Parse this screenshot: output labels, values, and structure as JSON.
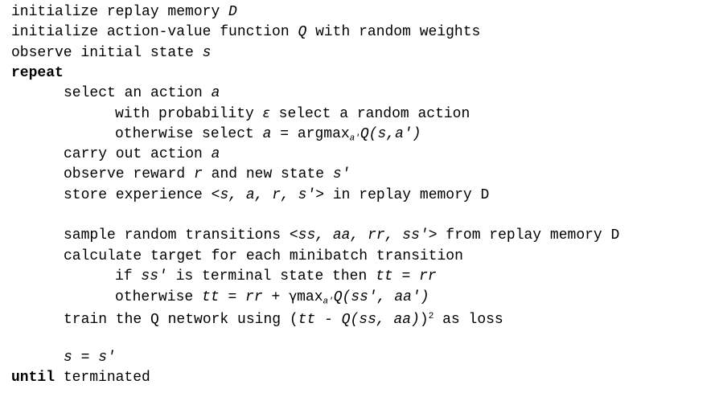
{
  "document": {
    "type": "algorithm-pseudocode",
    "title": "Deep Q-Learning with Experience Replay",
    "background_color": "#ffffff",
    "text_color": "#000000",
    "font_style": "monospace",
    "indent_char_width": 8
  },
  "lines": [
    {
      "id": "line-1",
      "indent": 0,
      "text": "initialize replay memory D",
      "segments": [
        {
          "t": "initialize replay memory ",
          "style": "plain"
        },
        {
          "t": "D",
          "style": "italic"
        }
      ]
    },
    {
      "id": "line-2",
      "indent": 0,
      "text": "initialize action-value function Q with random weights",
      "segments": [
        {
          "t": "initialize action-value function ",
          "style": "plain"
        },
        {
          "t": "Q",
          "style": "italic"
        },
        {
          "t": " with random weights",
          "style": "plain"
        }
      ]
    },
    {
      "id": "line-3",
      "indent": 0,
      "text": "observe initial state s",
      "segments": [
        {
          "t": "observe initial state ",
          "style": "plain"
        },
        {
          "t": "s",
          "style": "italic"
        }
      ]
    },
    {
      "id": "line-4",
      "indent": 0,
      "text": "repeat",
      "segments": [
        {
          "t": "repeat",
          "style": "bold"
        }
      ]
    },
    {
      "id": "line-5",
      "indent": 1,
      "text": "select an action a",
      "segments": [
        {
          "t": "select an action ",
          "style": "plain"
        },
        {
          "t": "a",
          "style": "italic"
        }
      ]
    },
    {
      "id": "line-6",
      "indent": 2,
      "text": "with probability ε select a random action",
      "segments": [
        {
          "t": "with probability ",
          "style": "plain"
        },
        {
          "t": "ε",
          "style": "greek-italic"
        },
        {
          "t": " select a random action",
          "style": "plain"
        }
      ]
    },
    {
      "id": "line-7",
      "indent": 2,
      "text": "otherwise select a = argmaxₐ′Q(s,a′)",
      "segments": [
        {
          "t": "otherwise select ",
          "style": "plain"
        },
        {
          "t": "a",
          "style": "italic"
        },
        {
          "t": " = argmax",
          "style": "plain"
        },
        {
          "t": "a′",
          "style": "subscript"
        },
        {
          "t": "Q(s,a′)",
          "style": "italic"
        }
      ]
    },
    {
      "id": "line-8",
      "indent": 1,
      "text": "carry out action a",
      "segments": [
        {
          "t": "carry out action ",
          "style": "plain"
        },
        {
          "t": "a",
          "style": "italic"
        }
      ]
    },
    {
      "id": "line-9",
      "indent": 1,
      "text": "observe reward r and new state s′",
      "segments": [
        {
          "t": "observe reward ",
          "style": "plain"
        },
        {
          "t": "r",
          "style": "italic"
        },
        {
          "t": " and new state ",
          "style": "plain"
        },
        {
          "t": "s′",
          "style": "italic"
        }
      ]
    },
    {
      "id": "line-10",
      "indent": 1,
      "text": "store experience <s, a, r, s′> in replay memory D",
      "segments": [
        {
          "t": "store experience <",
          "style": "plain"
        },
        {
          "t": "s, a, r, s′",
          "style": "italic"
        },
        {
          "t": "> in replay memory D",
          "style": "plain"
        }
      ]
    },
    {
      "id": "line-11",
      "indent": 0,
      "text": "",
      "segments": []
    },
    {
      "id": "line-12",
      "indent": 1,
      "text": "sample random transitions <ss, aa, rr, ss′> from replay memory D",
      "segments": [
        {
          "t": "sample random transitions <",
          "style": "plain"
        },
        {
          "t": "ss, aa, rr, ss′",
          "style": "italic"
        },
        {
          "t": "> from replay memory D",
          "style": "plain"
        }
      ]
    },
    {
      "id": "line-13",
      "indent": 1,
      "text": "calculate target for each minibatch transition",
      "segments": [
        {
          "t": "calculate target for each minibatch transition",
          "style": "plain"
        }
      ]
    },
    {
      "id": "line-14",
      "indent": 2,
      "text": "if ss′ is terminal state then tt = rr",
      "segments": [
        {
          "t": "if ",
          "style": "plain"
        },
        {
          "t": "ss′",
          "style": "italic"
        },
        {
          "t": " is terminal state then ",
          "style": "plain"
        },
        {
          "t": "tt",
          "style": "italic"
        },
        {
          "t": " = ",
          "style": "plain"
        },
        {
          "t": "rr",
          "style": "italic"
        }
      ]
    },
    {
      "id": "line-15",
      "indent": 2,
      "text": "otherwise tt = rr + γmaxₐ′Q(ss′, aa′)",
      "segments": [
        {
          "t": "otherwise ",
          "style": "plain"
        },
        {
          "t": "tt",
          "style": "italic"
        },
        {
          "t": " = ",
          "style": "plain"
        },
        {
          "t": "rr",
          "style": "italic"
        },
        {
          "t": " + ",
          "style": "plain"
        },
        {
          "t": "γ",
          "style": "greek"
        },
        {
          "t": "max",
          "style": "plain"
        },
        {
          "t": "a′",
          "style": "subscript"
        },
        {
          "t": "Q(ss′, aa′)",
          "style": "italic"
        }
      ]
    },
    {
      "id": "line-16",
      "indent": 1,
      "text": "train the Q network using (tt - Q(ss, aa))² as loss",
      "segments": [
        {
          "t": "train the Q network using (",
          "style": "plain"
        },
        {
          "t": "tt",
          "style": "italic"
        },
        {
          "t": " - ",
          "style": "plain"
        },
        {
          "t": "Q(ss, aa)",
          "style": "italic"
        },
        {
          "t": ")",
          "style": "plain"
        },
        {
          "t": "2",
          "style": "superscript"
        },
        {
          "t": " as loss",
          "style": "plain"
        }
      ]
    },
    {
      "id": "line-17",
      "indent": 0,
      "text": "",
      "segments": []
    },
    {
      "id": "line-18",
      "indent": 1,
      "text": "s = s′",
      "segments": [
        {
          "t": "s",
          "style": "italic"
        },
        {
          "t": " = ",
          "style": "plain"
        },
        {
          "t": "s′",
          "style": "italic"
        }
      ]
    },
    {
      "id": "line-19",
      "indent": 0,
      "text": "until terminated",
      "segments": [
        {
          "t": "until",
          "style": "bold"
        },
        {
          "t": " terminated",
          "style": "plain"
        }
      ]
    }
  ]
}
